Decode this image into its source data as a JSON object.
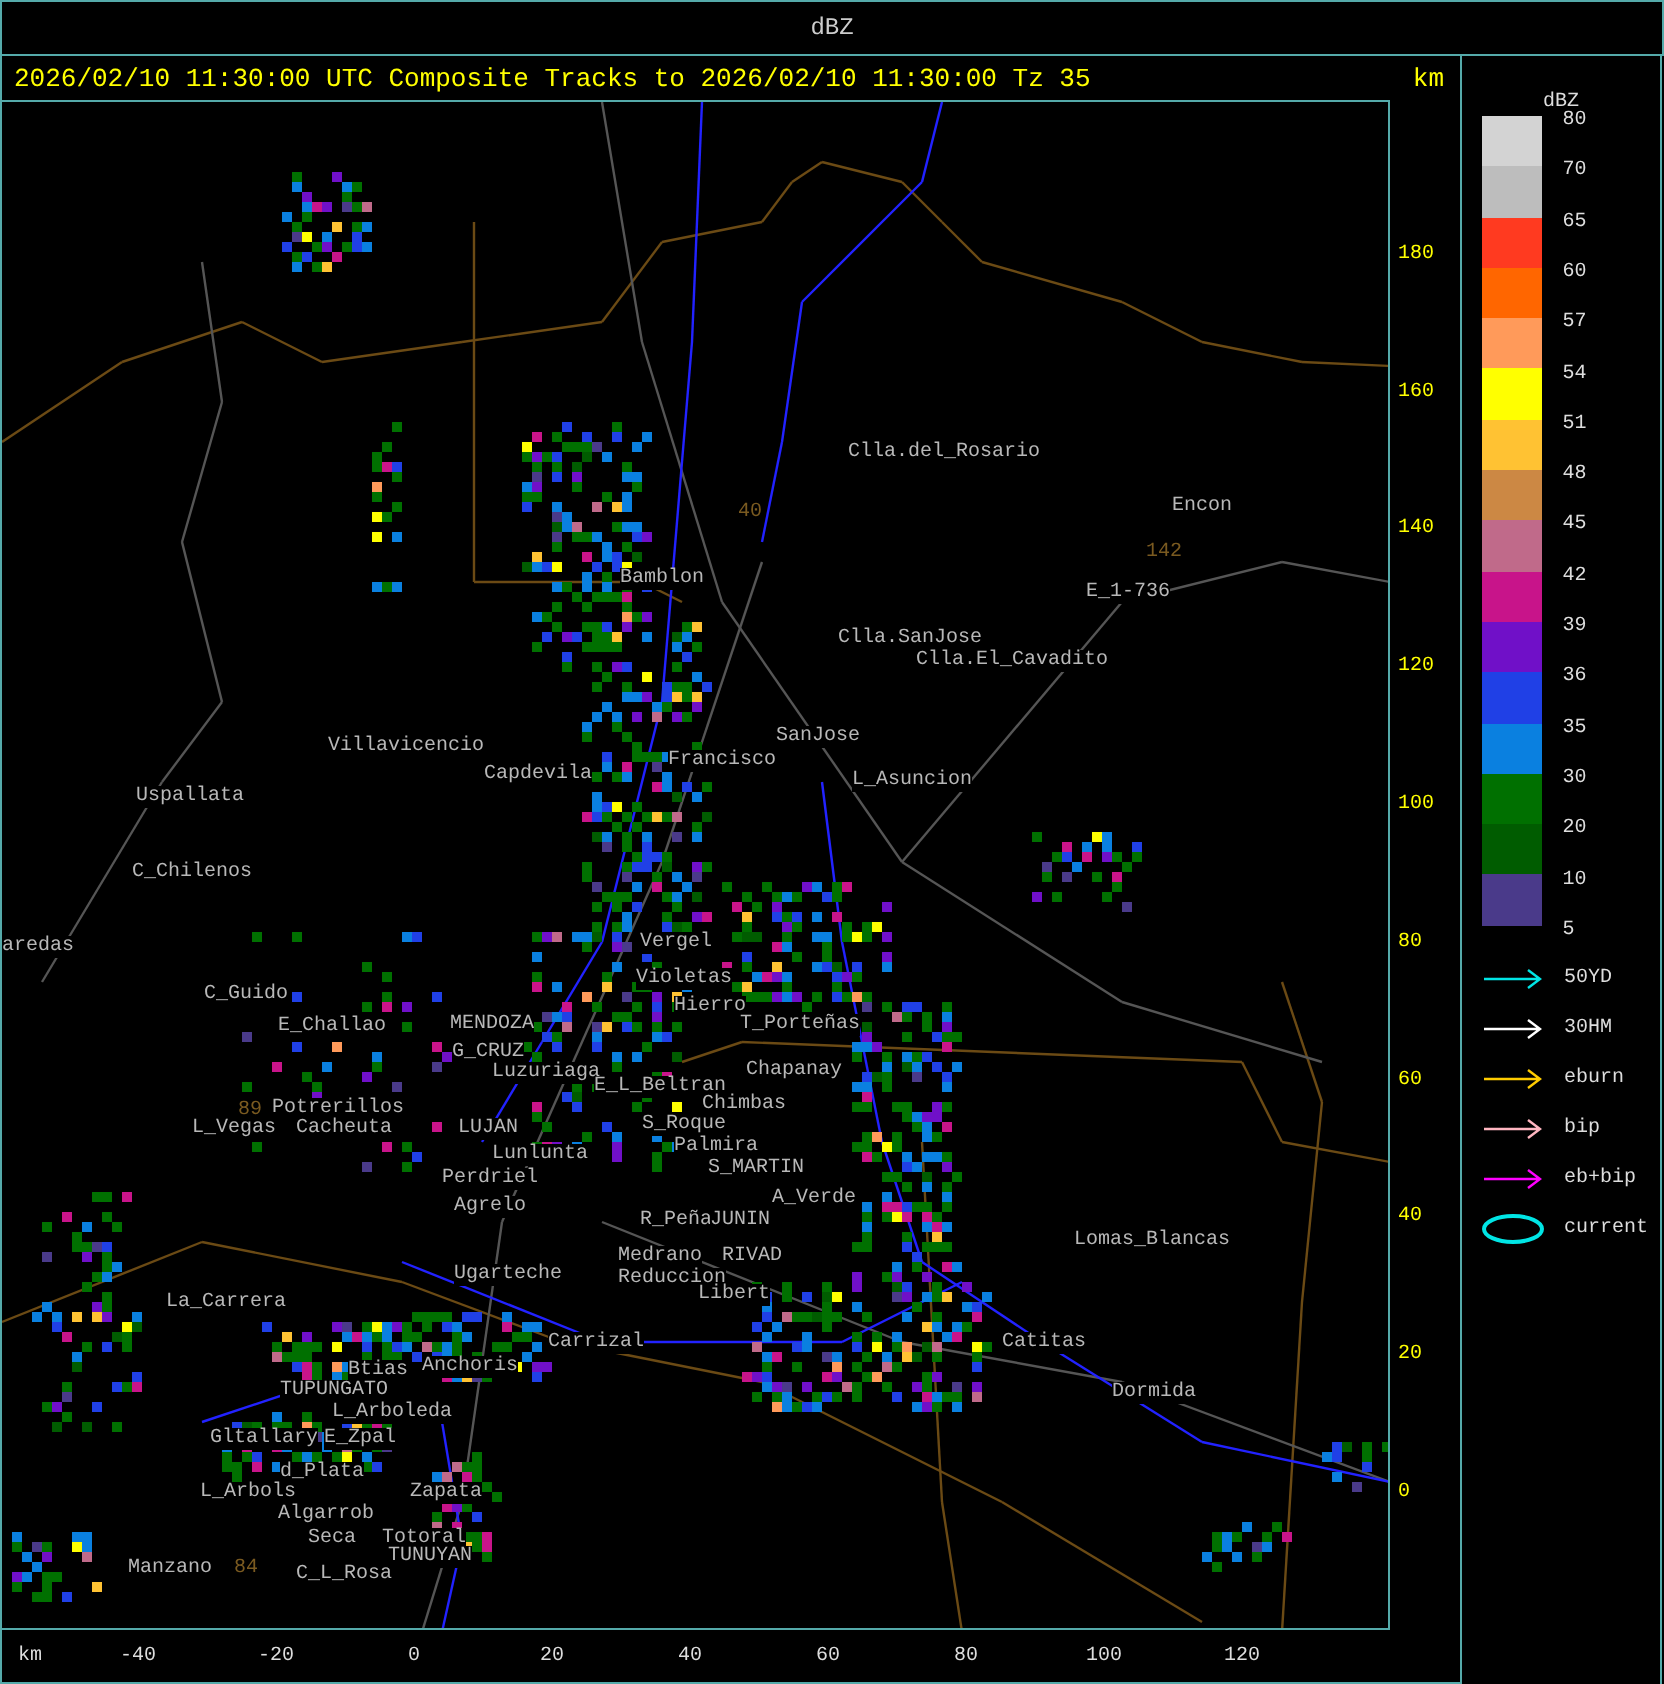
{
  "window": {
    "title": "dBZ"
  },
  "header": {
    "title": "2026/02/10 11:30:00 UTC Composite Tracks to 2026/02/10 11:30:00 Tz 35",
    "unit": "km"
  },
  "map": {
    "places": [
      "Clla.del_Rosario",
      "Encon",
      "E_1-736",
      "Clla.SanJose",
      "Clla.El_Cavadito",
      "Bamblon",
      "Villavicencio",
      "SanJose",
      "Capdevila",
      "Francisco",
      "L_Asuncion",
      "Uspallata",
      "C_Chilenos",
      "aredas",
      "Vergel",
      "Violetas",
      "C_Guido",
      "Hierro",
      "E_Challao",
      "MENDOZA",
      "T_Porteñas",
      "G_CRUZ",
      "Luzuriaga",
      "Chapanay",
      "E_L_Beltran",
      "Chimbas",
      "Potrerillos",
      "L_Vegas",
      "Cacheuta",
      "LUJAN",
      "S_Roque",
      "Lunlunta",
      "Palmira",
      "Perdriel",
      "S_MARTIN",
      "A_Verde",
      "Agrelo",
      "R_Peña",
      "JUNIN",
      "Lomas_Blancas",
      "Medrano",
      "Reduccion",
      "RIVAD",
      "Ugarteche",
      "La_Carrera",
      "Libert",
      "Carrizal",
      "Catitas",
      "Anchoris",
      "Btias",
      "TUPUNGATO",
      "Dormida",
      "L_Arboleda",
      "Gltallary",
      "E_Zpal",
      "d_Plata",
      "L_Arbols",
      "Zapata",
      "Algarrob",
      "Seca",
      "Totoral",
      "Manzano",
      "C_L_Rosa",
      "TUNUYAN"
    ],
    "road_numbers": [
      "40",
      "142",
      "89",
      "84"
    ],
    "y_ticks": [
      "180",
      "160",
      "140",
      "120",
      "100",
      "80",
      "60",
      "40",
      "20",
      "0"
    ],
    "x_ticks": [
      "-40",
      "-20",
      "0",
      "20",
      "40",
      "60",
      "80",
      "100",
      "120"
    ],
    "x_unit": "km"
  },
  "legend": {
    "title": "dBZ",
    "scale_labels": [
      "80",
      "70",
      "65",
      "60",
      "57",
      "54",
      "51",
      "48",
      "45",
      "42",
      "39",
      "36",
      "35",
      "30",
      "20",
      "10",
      "5"
    ],
    "segments": [
      {
        "color": "#d3d3d3"
      },
      {
        "color": "#bdbdbd"
      },
      {
        "color": "#ff3a20"
      },
      {
        "color": "#ff6600"
      },
      {
        "color": "#ff9a5a"
      },
      {
        "color": "#ffff00"
      },
      {
        "color": "#ffc233"
      },
      {
        "color": "#cc8844"
      },
      {
        "color": "#c06a8a"
      },
      {
        "color": "#c8148a"
      },
      {
        "color": "#7010c8"
      },
      {
        "color": "#2040e6"
      },
      {
        "color": "#0a80e0"
      },
      {
        "color": "#007000"
      },
      {
        "color": "#005c00"
      },
      {
        "color": "#4a3a8a"
      }
    ],
    "tracks": [
      {
        "kind": "arrow",
        "label": "50YD",
        "color": "#00e5e5"
      },
      {
        "kind": "arrow",
        "label": "30HM",
        "color": "#ffffff"
      },
      {
        "kind": "arrow",
        "label": "eburn",
        "color": "#ffcc00"
      },
      {
        "kind": "arrow",
        "label": "bip",
        "color": "#ffb6c1"
      },
      {
        "kind": "arrow",
        "label": "eb+bip",
        "color": "#ff00ff"
      },
      {
        "kind": "ellipse",
        "label": "current",
        "color": "#00e5e5"
      }
    ]
  }
}
